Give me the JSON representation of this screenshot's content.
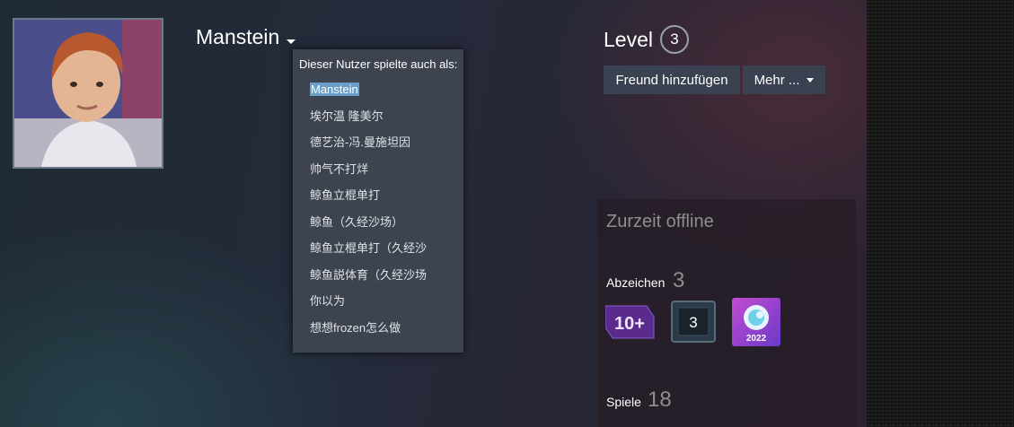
{
  "profile": {
    "persona_name": "Manstein",
    "level_label": "Level",
    "level_value": "3"
  },
  "alias_dropdown": {
    "title": "Dieser Nutzer spielte auch als:",
    "aliases": [
      "Manstein",
      "埃尔温 隆美尔",
      "德艺治-冯.曼施坦因",
      "帅气不打烊",
      "鲸鱼立棍单打",
      "鲸鱼（久经沙场）",
      "鲸鱼立棍单打（久经沙",
      "鲸鱼説体育（久经沙场",
      "你以为",
      "想想frozen怎么做"
    ],
    "selected_index": 0
  },
  "actions": {
    "add_friend": "Freund hinzufügen",
    "more": "Mehr ..."
  },
  "status_panel": {
    "status": "Zurzeit offline",
    "badges_label": "Abzeichen",
    "badges_count": "3",
    "badge_items": [
      {
        "icon": "years-of-service-badge-icon",
        "text": "10+"
      },
      {
        "icon": "level-badge-icon",
        "text": "3"
      },
      {
        "icon": "steam-replay-badge-icon",
        "text": "2022"
      }
    ],
    "games_label": "Spiele",
    "games_count": "18"
  },
  "colors": {
    "selection": "#6a9ec9",
    "dropdown_bg": "#3d4450",
    "button_bg": "#3a4150"
  }
}
